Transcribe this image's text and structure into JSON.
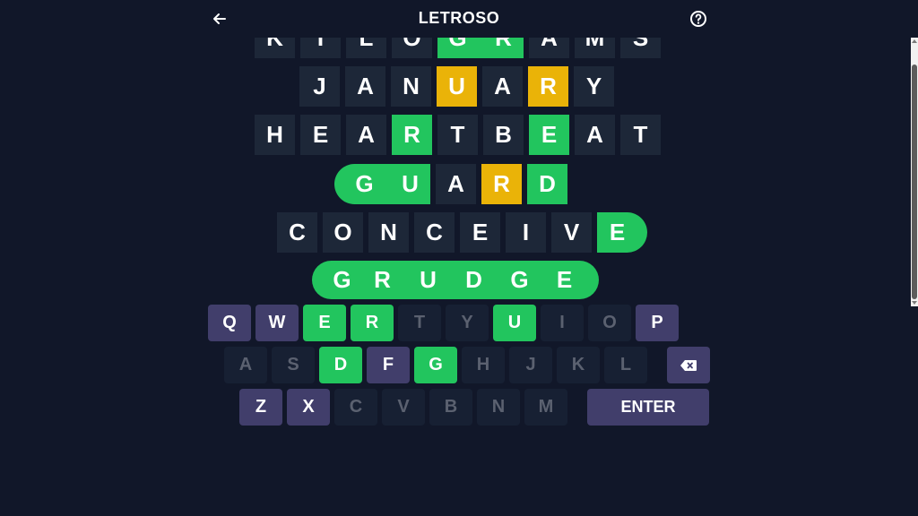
{
  "header": {
    "title": "LETROSO",
    "back_icon": "arrow-left-icon",
    "help_icon": "help-circle-icon"
  },
  "colors": {
    "background": "#111729",
    "tile_empty": "#1d2738",
    "correct": "#22c55e",
    "present": "#eab308",
    "key_used": "#413e6b"
  },
  "board": {
    "rows": [
      {
        "word": "KILOGRAMS",
        "letters": [
          "K",
          "I",
          "L",
          "O",
          "G",
          "R",
          "A",
          "M",
          "S"
        ],
        "states": [
          "absent",
          "absent",
          "absent",
          "absent",
          "correct",
          "correct",
          "absent",
          "absent",
          "absent"
        ]
      },
      {
        "word": "JANUARY",
        "letters": [
          "J",
          "A",
          "N",
          "U",
          "A",
          "R",
          "Y"
        ],
        "states": [
          "absent",
          "absent",
          "absent",
          "present",
          "absent",
          "present",
          "absent"
        ]
      },
      {
        "word": "HEARTBEAT",
        "letters": [
          "H",
          "E",
          "A",
          "R",
          "T",
          "B",
          "E",
          "A",
          "T"
        ],
        "states": [
          "absent",
          "absent",
          "absent",
          "correct",
          "absent",
          "absent",
          "correct",
          "absent",
          "absent"
        ]
      },
      {
        "word": "GUARD",
        "letters": [
          "G",
          "U",
          "A",
          "R",
          "D"
        ],
        "states": [
          "correct",
          "correct",
          "absent",
          "present",
          "correct"
        ]
      },
      {
        "word": "CONCEIVE",
        "letters": [
          "C",
          "O",
          "N",
          "C",
          "E",
          "I",
          "V",
          "E"
        ],
        "states": [
          "absent",
          "absent",
          "absent",
          "absent",
          "absent",
          "absent",
          "absent",
          "correct"
        ]
      },
      {
        "word": "GRUDGE",
        "letters": [
          "G",
          "R",
          "U",
          "D",
          "G",
          "E"
        ],
        "states": [
          "correct",
          "correct",
          "correct",
          "correct",
          "correct",
          "correct"
        ]
      }
    ]
  },
  "keyboard": {
    "row1": [
      {
        "label": "Q",
        "state": "used"
      },
      {
        "label": "W",
        "state": "used"
      },
      {
        "label": "E",
        "state": "green"
      },
      {
        "label": "R",
        "state": "green"
      },
      {
        "label": "T",
        "state": "absent"
      },
      {
        "label": "Y",
        "state": "absent"
      },
      {
        "label": "U",
        "state": "green"
      },
      {
        "label": "I",
        "state": "absent"
      },
      {
        "label": "O",
        "state": "absent"
      },
      {
        "label": "P",
        "state": "used"
      }
    ],
    "row2": [
      {
        "label": "A",
        "state": "absent"
      },
      {
        "label": "S",
        "state": "absent"
      },
      {
        "label": "D",
        "state": "green"
      },
      {
        "label": "F",
        "state": "used"
      },
      {
        "label": "G",
        "state": "green"
      },
      {
        "label": "H",
        "state": "absent"
      },
      {
        "label": "J",
        "state": "absent"
      },
      {
        "label": "K",
        "state": "absent"
      },
      {
        "label": "L",
        "state": "absent"
      }
    ],
    "backspace_icon": "backspace-icon",
    "row3": [
      {
        "label": "Z",
        "state": "used"
      },
      {
        "label": "X",
        "state": "used"
      },
      {
        "label": "C",
        "state": "absent"
      },
      {
        "label": "V",
        "state": "absent"
      },
      {
        "label": "B",
        "state": "absent"
      },
      {
        "label": "N",
        "state": "absent"
      },
      {
        "label": "M",
        "state": "absent"
      }
    ],
    "enter_label": "ENTER"
  }
}
